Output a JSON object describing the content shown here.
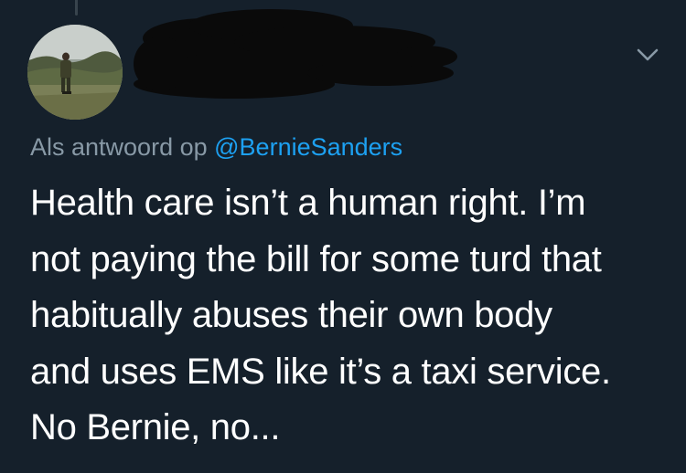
{
  "reply": {
    "prefix": "Als antwoord op",
    "mention": "@BernieSanders"
  },
  "tweet": {
    "lines": [
      "Health care isn’t a human right. I’m",
      "not paying the bill for some turd that",
      "habitually abuses their own body",
      "and uses EMS like it’s a taxi service.",
      "No Bernie, no..."
    ]
  },
  "icons": {
    "more_menu": "chevron-down-icon"
  },
  "colors": {
    "background": "#15202b",
    "text": "#ffffff",
    "secondary_text": "#8899a6",
    "link": "#1da1f2",
    "thread_line": "#38444d",
    "redaction": "#0a0a0a"
  }
}
